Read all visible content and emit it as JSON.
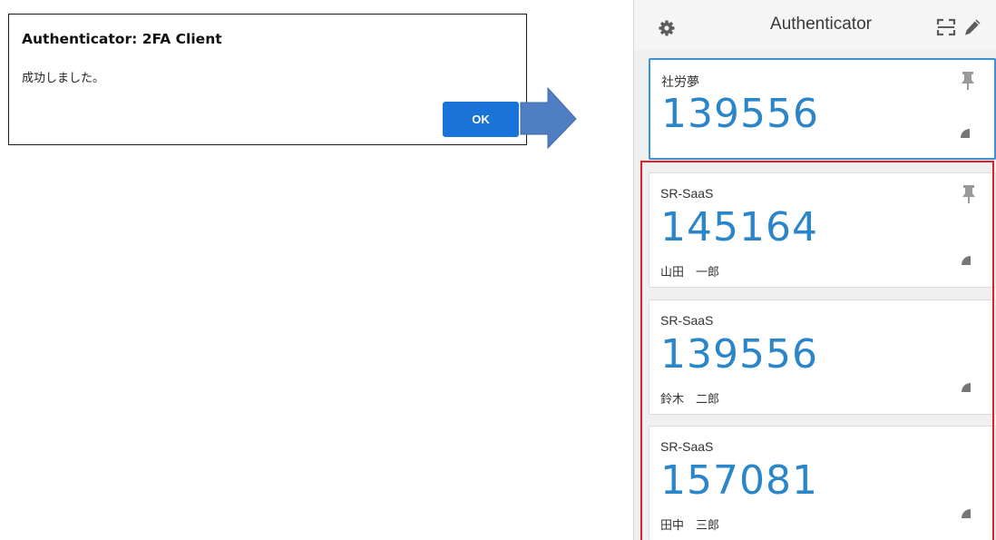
{
  "dialog": {
    "title": "Authenticator: 2FA Client",
    "message": "成功しました。",
    "ok_label": "OK"
  },
  "app": {
    "title": "Authenticator",
    "icons": [
      "gear-icon",
      "scan-icon",
      "pencil-icon"
    ]
  },
  "accounts": [
    {
      "issuer": "社労夢",
      "code": "139556",
      "account": "",
      "pinned": true,
      "selected": true
    },
    {
      "issuer": "SR-SaaS",
      "code": "145164",
      "account": "山田　一郎",
      "pinned": true,
      "selected": false
    },
    {
      "issuer": "SR-SaaS",
      "code": "139556",
      "account": "鈴木　二郎",
      "pinned": false,
      "selected": false
    },
    {
      "issuer": "SR-SaaS",
      "code": "157081",
      "account": "田中　三郎",
      "pinned": false,
      "selected": false
    }
  ],
  "colors": {
    "ok_button": "#1a73d6",
    "arrow": "#4f7fc2",
    "code_text": "#2a85c9",
    "selected_border": "#3b92d6",
    "highlight": "#e0202a"
  }
}
